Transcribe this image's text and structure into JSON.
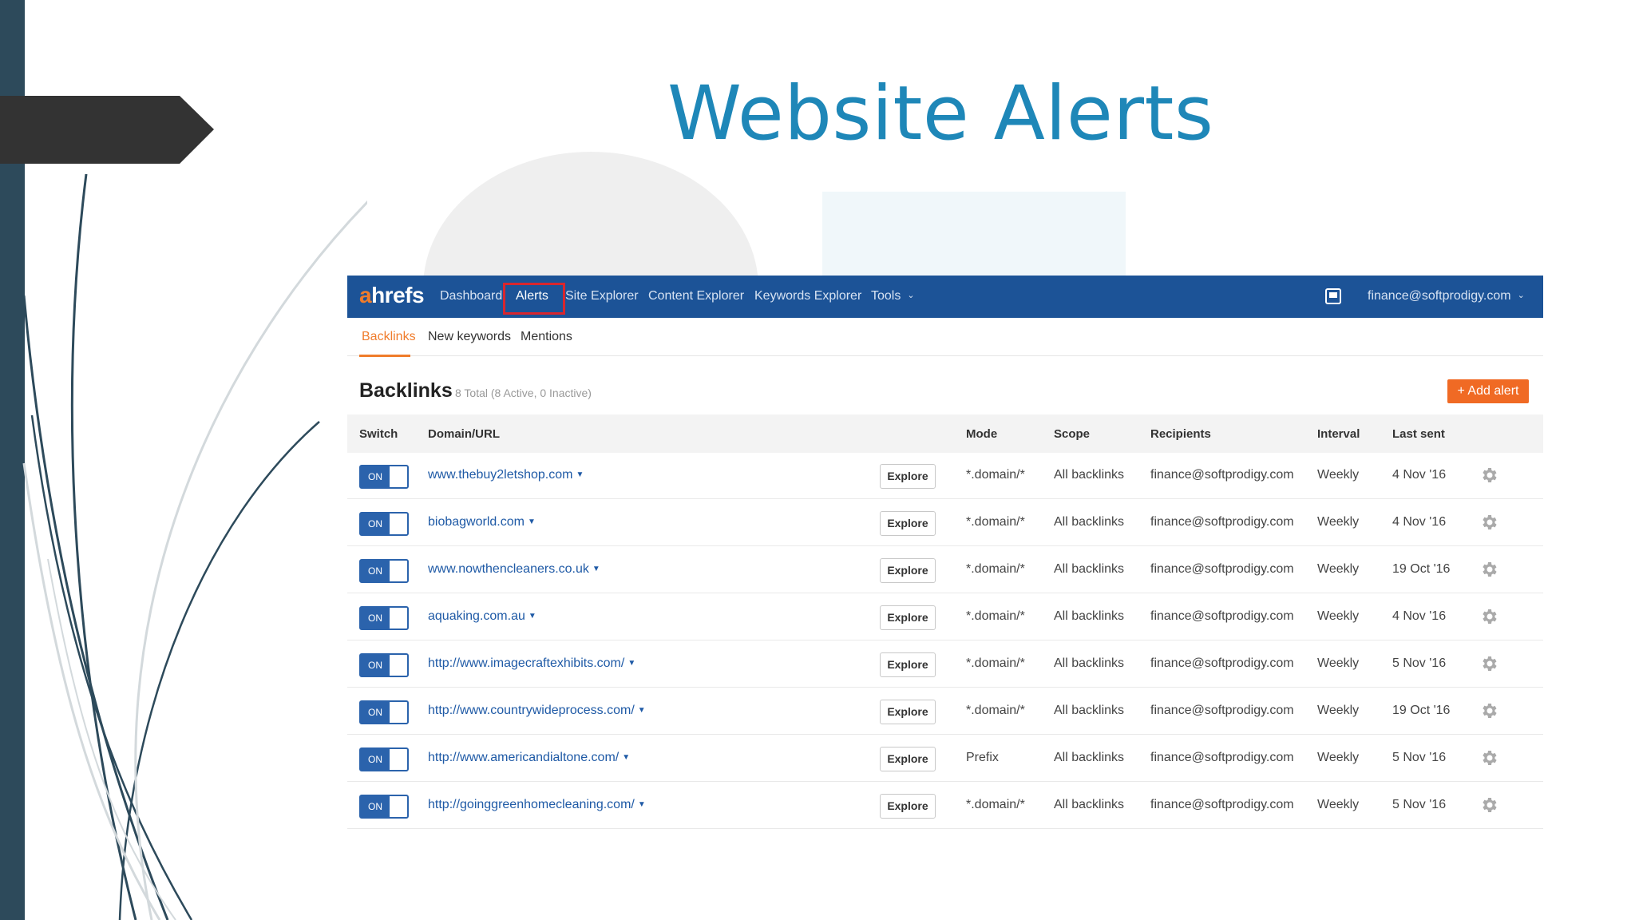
{
  "slide": {
    "title": "Website Alerts"
  },
  "colors": {
    "nav_bg": "#1c5397",
    "accent": "#f07c2b",
    "add_button": "#f06a24",
    "link": "#1f5aa6",
    "highlight_box": "#d8262e",
    "title": "#1e87b8"
  },
  "nav": {
    "logo_a": "a",
    "logo_rest": "hrefs",
    "items": [
      "Dashboard",
      "Alerts",
      "Site Explorer",
      "Content Explorer",
      "Keywords Explorer",
      "Tools"
    ],
    "active": "Alerts",
    "user_email": "finance@softprodigy.com"
  },
  "subtabs": {
    "items": [
      "Backlinks",
      "New keywords",
      "Mentions"
    ],
    "active": "Backlinks"
  },
  "section": {
    "title": "Backlinks",
    "subtitle": "8 Total (8 Active, 0 Inactive)",
    "add_button": "+ Add alert"
  },
  "table": {
    "headers": [
      "Switch",
      "Domain/URL",
      "Mode",
      "Scope",
      "Recipients",
      "Interval",
      "Last sent"
    ],
    "toggle_label": "ON",
    "explore_label": "Explore",
    "rows": [
      {
        "domain": "www.thebuy2letshop.com",
        "mode": "*.domain/*",
        "scope": "All backlinks",
        "recipients": "finance@softprodigy.com",
        "interval": "Weekly",
        "last_sent": "4 Nov '16"
      },
      {
        "domain": "biobagworld.com",
        "mode": "*.domain/*",
        "scope": "All backlinks",
        "recipients": "finance@softprodigy.com",
        "interval": "Weekly",
        "last_sent": "4 Nov '16"
      },
      {
        "domain": "www.nowthencleaners.co.uk",
        "mode": "*.domain/*",
        "scope": "All backlinks",
        "recipients": "finance@softprodigy.com",
        "interval": "Weekly",
        "last_sent": "19 Oct '16"
      },
      {
        "domain": "aquaking.com.au",
        "mode": "*.domain/*",
        "scope": "All backlinks",
        "recipients": "finance@softprodigy.com",
        "interval": "Weekly",
        "last_sent": "4 Nov '16"
      },
      {
        "domain": "http://www.imagecraftexhibits.com/",
        "mode": "*.domain/*",
        "scope": "All backlinks",
        "recipients": "finance@softprodigy.com",
        "interval": "Weekly",
        "last_sent": "5 Nov '16"
      },
      {
        "domain": "http://www.countrywideprocess.com/",
        "mode": "*.domain/*",
        "scope": "All backlinks",
        "recipients": "finance@softprodigy.com",
        "interval": "Weekly",
        "last_sent": "19 Oct '16"
      },
      {
        "domain": "http://www.americandialtone.com/",
        "mode": "Prefix",
        "scope": "All backlinks",
        "recipients": "finance@softprodigy.com",
        "interval": "Weekly",
        "last_sent": "5 Nov '16"
      },
      {
        "domain": "http://goinggreenhomecleaning.com/",
        "mode": "*.domain/*",
        "scope": "All backlinks",
        "recipients": "finance@softprodigy.com",
        "interval": "Weekly",
        "last_sent": "5 Nov '16"
      }
    ]
  }
}
